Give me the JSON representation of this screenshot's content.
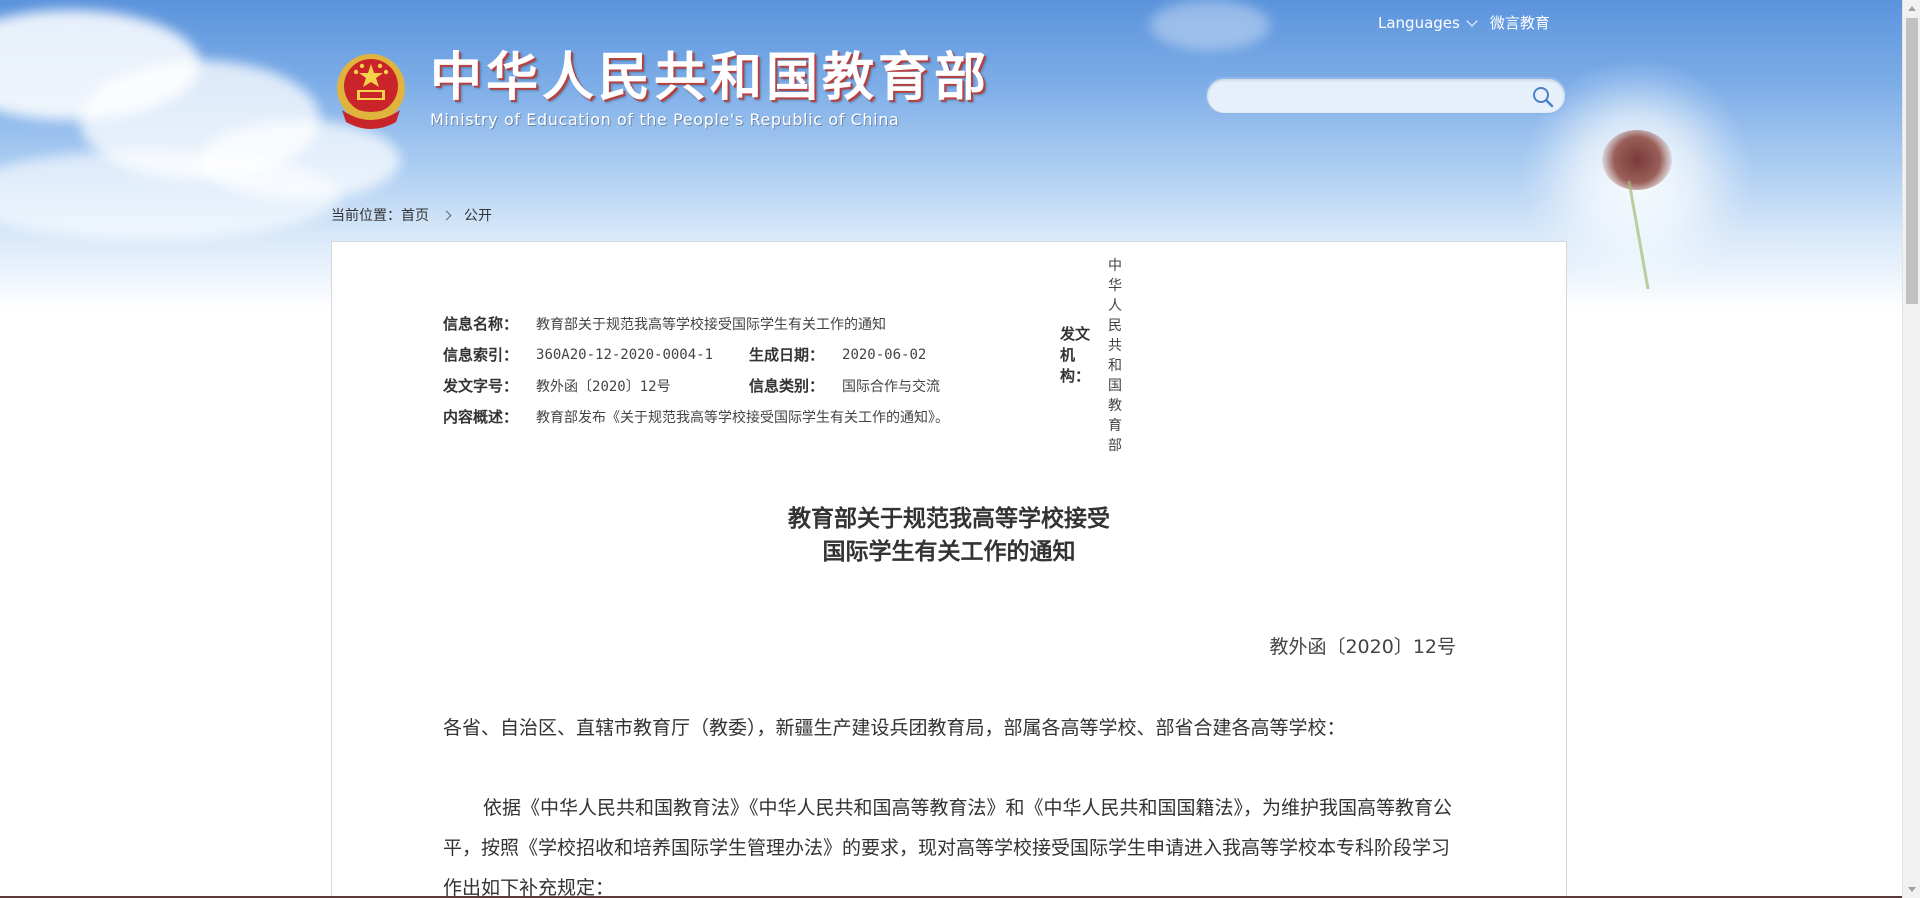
{
  "header": {
    "languages_label": "Languages",
    "weibo_label": "微言教育",
    "title_cn": "中华人民共和国教育部",
    "title_en": "Ministry of Education of the People's Republic of China",
    "search_placeholder": ""
  },
  "breadcrumb": {
    "prefix": "当前位置：",
    "home": "首页",
    "current": "公开"
  },
  "meta": {
    "name_label": "信息名称：",
    "name_value": "教育部关于规范我高等学校接受国际学生有关工作的通知",
    "index_label": "信息索引：",
    "index_value": "360A20-12-2020-0004-1",
    "date_label": "生成日期：",
    "date_value": "2020-06-02",
    "org_label": "发文机构：",
    "org_value": "中华人民共和国教育部",
    "docno_label": "发文字号：",
    "docno_value": "教外函〔2020〕12号",
    "category_label": "信息类别：",
    "category_value": "国际合作与交流",
    "summary_label": "内容概述：",
    "summary_value": "教育部发布《关于规范我高等学校接受国际学生有关工作的通知》。"
  },
  "article": {
    "title_line1": "教育部关于规范我高等学校接受",
    "title_line2": "国际学生有关工作的通知",
    "doc_number": "教外函〔2020〕12号",
    "salutation": "各省、自治区、直辖市教育厅（教委），新疆生产建设兵团教育局，部属各高等学校、部省合建各高等学校：",
    "paragraph1": "依据《中华人民共和国教育法》《中华人民共和国高等教育法》和《中华人民共和国国籍法》，为维护我国高等教育公平，按照《学校招收和培养国际学生管理办法》的要求，现对高等学校接受国际学生申请进入我高等学校本专科阶段学习作出如下补充规定："
  }
}
